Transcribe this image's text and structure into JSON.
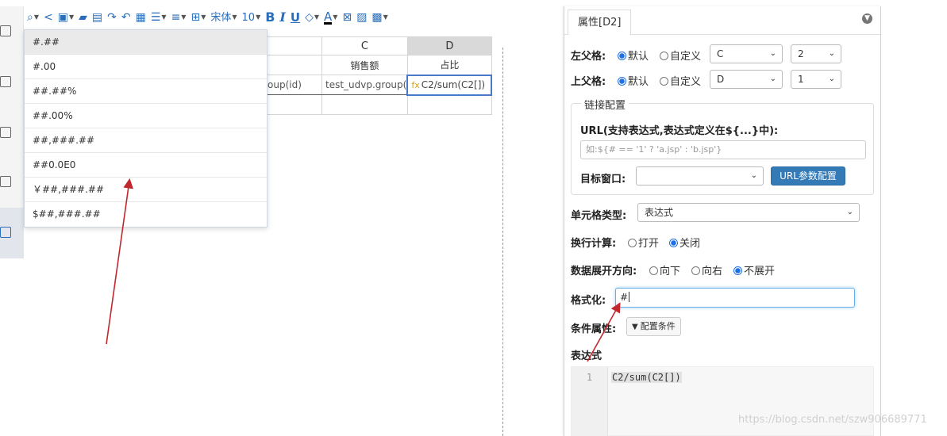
{
  "toolbar": {
    "font_name": "宋体",
    "font_size": "10",
    "bold": "B",
    "italic": "I",
    "underline": "U",
    "font_color": "A"
  },
  "grid": {
    "col_c": "C",
    "col_d": "D",
    "header_c": "销售额",
    "header_d": "占比",
    "cell_b2": "oup(id)",
    "cell_c2": "test_udvp.group(",
    "cell_d2": "C2/sum(C2[])",
    "cell_d2_icon": "fx"
  },
  "format_dropdown": {
    "options": [
      "#.##",
      "#.00",
      "##.##%",
      "##.00%",
      "##,###.##",
      "##0.0E0",
      "￥##,###.##",
      "$##,###.##"
    ],
    "highlighted_index": 0
  },
  "panel": {
    "tab_title": "属性[D2]",
    "left_parent": {
      "label": "左父格:",
      "opt_default": "默认",
      "opt_custom": "自定义",
      "selected": "default",
      "column": "C",
      "row": "2"
    },
    "top_parent": {
      "label": "上父格:",
      "opt_default": "默认",
      "opt_custom": "自定义",
      "selected": "default",
      "column": "D",
      "row": "1"
    },
    "link": {
      "legend": "链接配置",
      "url_label": "URL(支持表达式,表达式定义在${...}中):",
      "url_placeholder": "如:${# == '1' ? 'a.jsp' : 'b.jsp'}",
      "target_label": "目标窗口:",
      "target_value": "",
      "param_button": "URL参数配置"
    },
    "cell_type": {
      "label": "单元格类型:",
      "value": "表达式"
    },
    "wrap_calc": {
      "label": "换行计算:",
      "opt_open": "打开",
      "opt_close": "关闭",
      "selected": "close"
    },
    "expand_dir": {
      "label": "数据展开方向:",
      "opt_down": "向下",
      "opt_right": "向右",
      "opt_none": "不展开",
      "selected": "none"
    },
    "format": {
      "label": "格式化:",
      "value": "#"
    },
    "condition": {
      "label": "条件属性:",
      "button": "配置条件"
    },
    "expression": {
      "label": "表达式",
      "line_no": "1",
      "code": "C2/sum(C2[])"
    }
  },
  "watermark": "https://blog.csdn.net/szw906689771",
  "colors": {
    "accent": "#2a6ebb",
    "primary_button": "#337ab7",
    "radio_on": "#1f6fe5",
    "annotation_arrow": "#c0282d"
  }
}
